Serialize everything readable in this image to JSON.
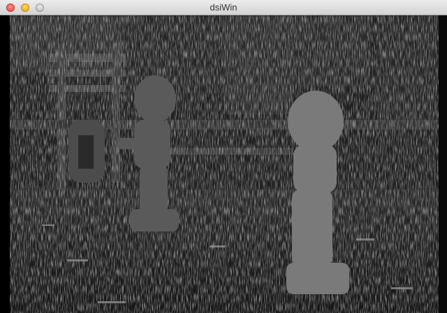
{
  "window": {
    "title": "dsiWin",
    "buttons": [
      "close-button",
      "minimize-button",
      "zoom-button"
    ]
  },
  "image": {
    "description_icon": "depth-map-image"
  }
}
